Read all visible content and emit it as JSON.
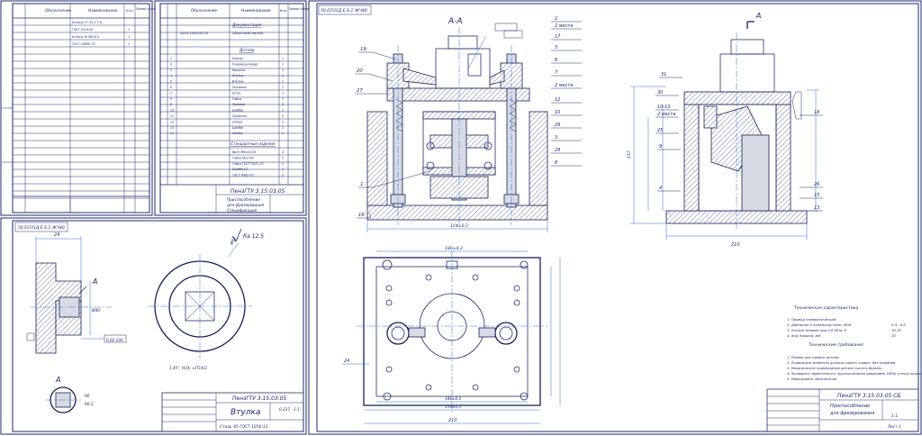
{
  "spec_table_1": {
    "headers": [
      "Обозначение",
      "Наименование",
      "Кол.",
      "Приме-чание"
    ],
    "rows": [
      {
        "name": "Кольцо 17-20-2.7-8",
        "qty": ""
      },
      {
        "name": "ГОСТ 9.6-8-61",
        "qty": "1"
      },
      {
        "name": "Кольцо Ф 083.А-5",
        "qty": "1"
      },
      {
        "name": "ГОСТ 16650-72",
        "qty": "1"
      }
    ]
  },
  "spec_table_2": {
    "headers": [
      "Обозначение",
      "Наименование",
      "Кол.",
      "Приме-чание"
    ],
    "sections": {
      "documentation": "Документация",
      "details": "Детали",
      "standard": "Стандартные изделия"
    },
    "doc_row": {
      "code": "XXXX.XXXX.00 СБ",
      "name": "Сборочный чертеж"
    },
    "detail_rows": [
      {
        "pos": "1",
        "name": "Корпус",
        "qty": "1"
      },
      {
        "pos": "2",
        "name": "Пневмоцилиндр",
        "qty": "1"
      },
      {
        "pos": "3",
        "name": "Крышка",
        "qty": "1"
      },
      {
        "pos": "4",
        "name": "Втулка",
        "qty": "1"
      },
      {
        "pos": "5",
        "name": "Втулка",
        "qty": "1"
      },
      {
        "pos": "6",
        "name": "Поршень",
        "qty": "1"
      },
      {
        "pos": "7",
        "name": "Шток",
        "qty": "1"
      },
      {
        "pos": "8",
        "name": "Гайка",
        "qty": "1"
      },
      {
        "pos": "9",
        "name": "Прихват",
        "qty": "2"
      },
      {
        "pos": "10",
        "name": "Шайба",
        "qty": "2"
      },
      {
        "pos": "11",
        "name": "Пружина",
        "qty": "2"
      },
      {
        "pos": "12",
        "name": "Опора",
        "qty": "2"
      },
      {
        "pos": "13",
        "name": "Шайба",
        "qty": "1"
      },
      {
        "pos": "14",
        "name": "Палец",
        "qty": "1"
      }
    ],
    "standard_rows": [
      {
        "name": "Винт M6x16.58",
        "qty": "4"
      },
      {
        "name": "Гайка M12-6H",
        "qty": "2"
      },
      {
        "name": "Гайка ГОСТ 5915-70",
        "qty": "2"
      },
      {
        "name": "Шайба 12",
        "qty": "2"
      },
      {
        "name": "ГОСТ 6402-70",
        "qty": "2"
      }
    ]
  },
  "title_block_spec": {
    "code": "ПензГТУ 3.15.03.05",
    "name_line1": "Приспособление",
    "name_line2": "для фрезерования",
    "doc_type": "Спецификация"
  },
  "part_drawing": {
    "corner_code": "50 ЕОЗ1Д Е 6,1 ЖЧ40",
    "roughness": "Ra 12,5",
    "section_label": "A",
    "dim_24": "24",
    "dim_d40": "Ø40",
    "tolerance_frame": "0,02 100",
    "dim_d52": "Ø52",
    "note_angle": "1.45°, H14, ±IT14/2",
    "chamfer_1": "R6",
    "chamfer_2": "R6,3",
    "title_code": "ПензГТУ 3.15.03.05",
    "title_name": "Втулка",
    "material": "Сталь 45 ГОСТ 1050-13",
    "scale": "1:1",
    "mass": "0,237"
  },
  "assembly": {
    "corner_code": "50 ЕОЗ1Д Е 6,1 ЖЧ40",
    "section_title": "А-А",
    "arrow_label": "A",
    "leaders_left": [
      "19",
      "20",
      "27",
      "1",
      "16"
    ],
    "leaders_right": [
      "2",
      "2 места",
      "17",
      "5",
      "6",
      "7",
      "2 места",
      "12",
      "10",
      "29",
      "3",
      "28",
      "8"
    ],
    "leaders_side_left": [
      "31",
      "30",
      "10-13",
      "2 места",
      "25",
      "9",
      "4"
    ],
    "leaders_side_right": [
      "18",
      "26",
      "15",
      "13"
    ],
    "dim_main_width": "154±0,3",
    "dim_side_width": "210",
    "dim_height": "157",
    "dim_plan_top": "186±0,2",
    "dim_plan_inner": "186±0,2",
    "dim_plan_bottom": "154±0,3",
    "dim_plan_total": "210",
    "leader_plan": "24",
    "tech_char_title": "Техническая характеристика",
    "tech_char": [
      {
        "text": "1. Привод пневматический",
        "val": ""
      },
      {
        "text": "2. Давление в пневмосистеме, МПа",
        "val": "0,4...0,6"
      },
      {
        "text": "3. Усилие зажима при 0,6 МПа, Н",
        "val": "16,30"
      },
      {
        "text": "4. Ход поршня, мм",
        "val": "20"
      }
    ],
    "tech_req_title": "Технические требования",
    "tech_req": [
      "1. Размер для справок детали.",
      "2. Подвижные элементы должны ходить плавно, без заеданий.",
      "3. Механическое повреждение детали считать браком.",
      "4. Проверить герметичность приспособления давлением 1МПа, утечка недопустима.",
      "5. Маркировать обозначение."
    ],
    "title_code": "ПензГТУ 3.15.03.05 СБ",
    "title_name_1": "Приспособление",
    "title_name_2": "для фрезерования",
    "scale": "1:1",
    "sheet": "Лист 1"
  }
}
